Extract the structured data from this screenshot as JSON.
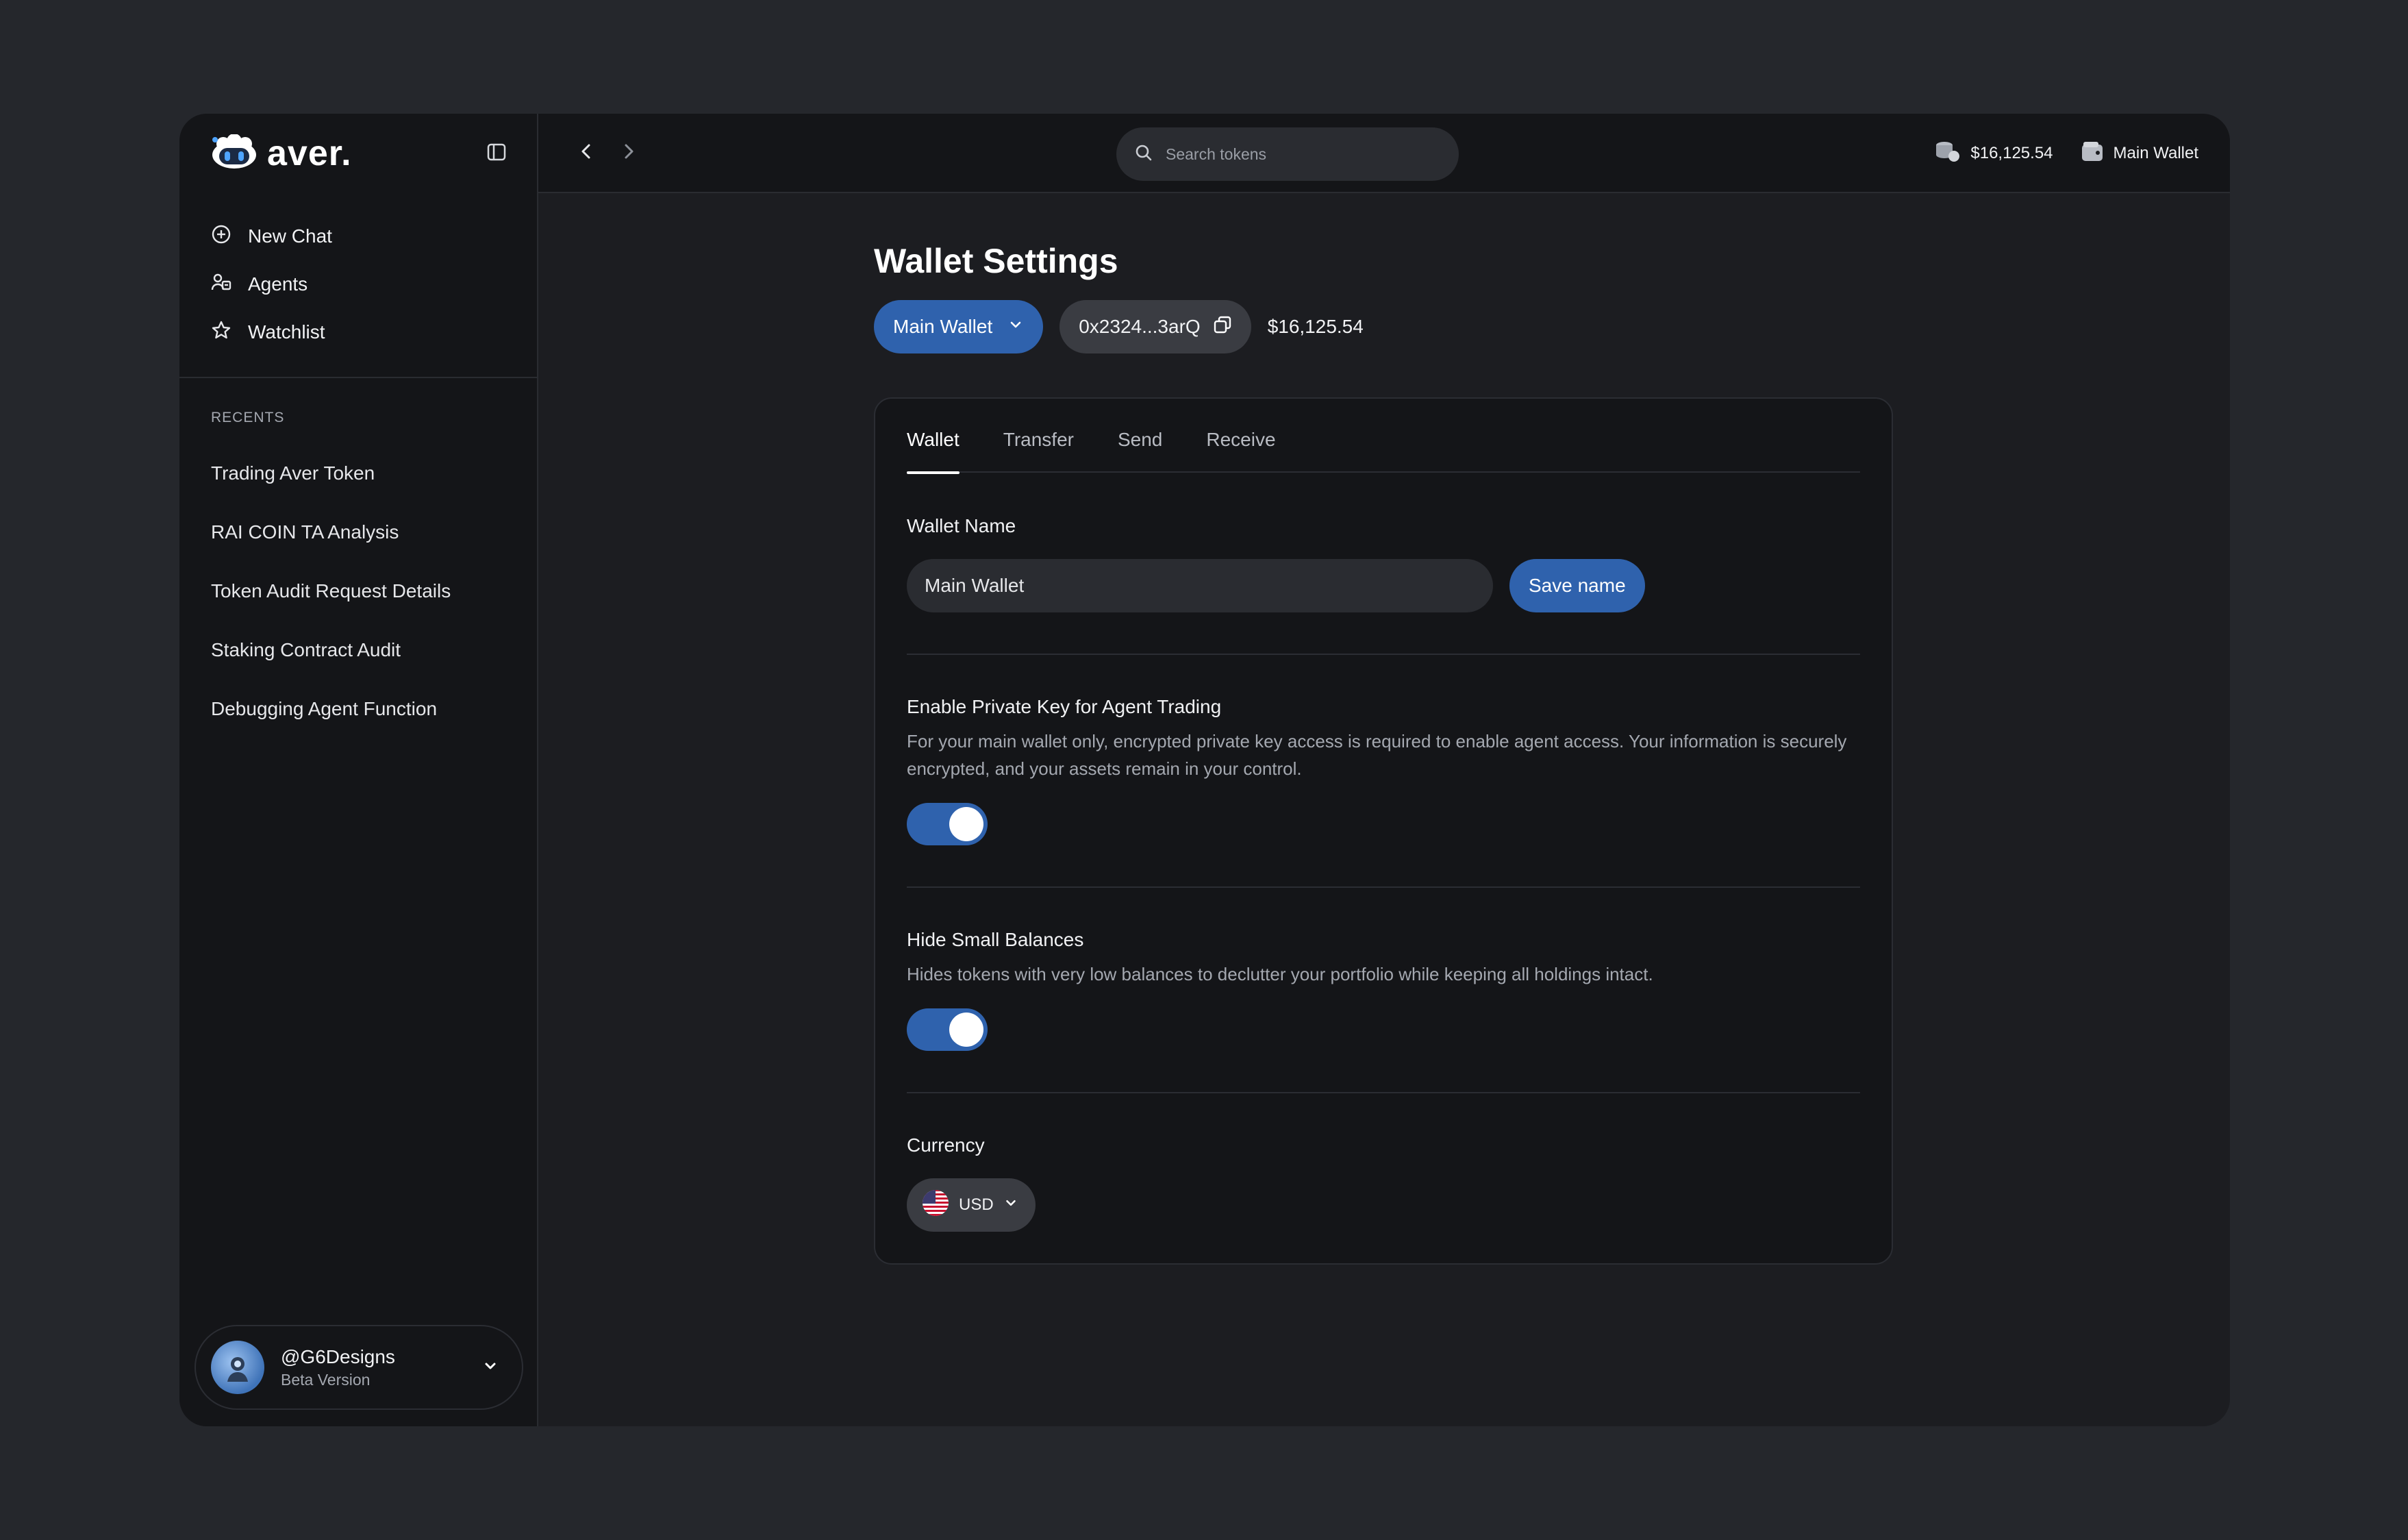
{
  "app": {
    "logo_text": "aver.",
    "accent_color": "#2f62ad"
  },
  "sidebar": {
    "nav": [
      {
        "label": "New Chat",
        "icon": "plus-circle-icon"
      },
      {
        "label": "Agents",
        "icon": "agents-icon"
      },
      {
        "label": "Watchlist",
        "icon": "star-icon"
      }
    ],
    "recents_title": "RECENTS",
    "recents": [
      "Trading Aver Token",
      "RAI COIN TA Analysis",
      "Token Audit Request Details",
      "Staking Contract Audit",
      "Debugging Agent Function"
    ],
    "user": {
      "handle": "@G6Designs",
      "subtitle": "Beta Version"
    }
  },
  "topbar": {
    "search_placeholder": "Search tokens",
    "balance": "$16,125.54",
    "wallet_label": "Main Wallet"
  },
  "page": {
    "title": "Wallet Settings",
    "wallet_select": "Main Wallet",
    "address": "0x2324...3arQ",
    "balance": "$16,125.54"
  },
  "tabs": [
    {
      "label": "Wallet",
      "active": true
    },
    {
      "label": "Transfer",
      "active": false
    },
    {
      "label": "Send",
      "active": false
    },
    {
      "label": "Receive",
      "active": false
    }
  ],
  "wallet_name": {
    "label": "Wallet Name",
    "value": "Main Wallet",
    "save_label": "Save name"
  },
  "settings": {
    "private_key": {
      "title": "Enable Private Key for Agent Trading",
      "description": "For your main wallet only, encrypted private key access is required to enable agent access. Your information is securely encrypted, and your assets remain in your control.",
      "enabled": true
    },
    "hide_small": {
      "title": "Hide Small Balances",
      "description": "Hides tokens with very low balances to declutter your portfolio while keeping all holdings intact.",
      "enabled": true
    }
  },
  "currency": {
    "label": "Currency",
    "value": "USD",
    "flag_icon": "us-flag-icon"
  }
}
